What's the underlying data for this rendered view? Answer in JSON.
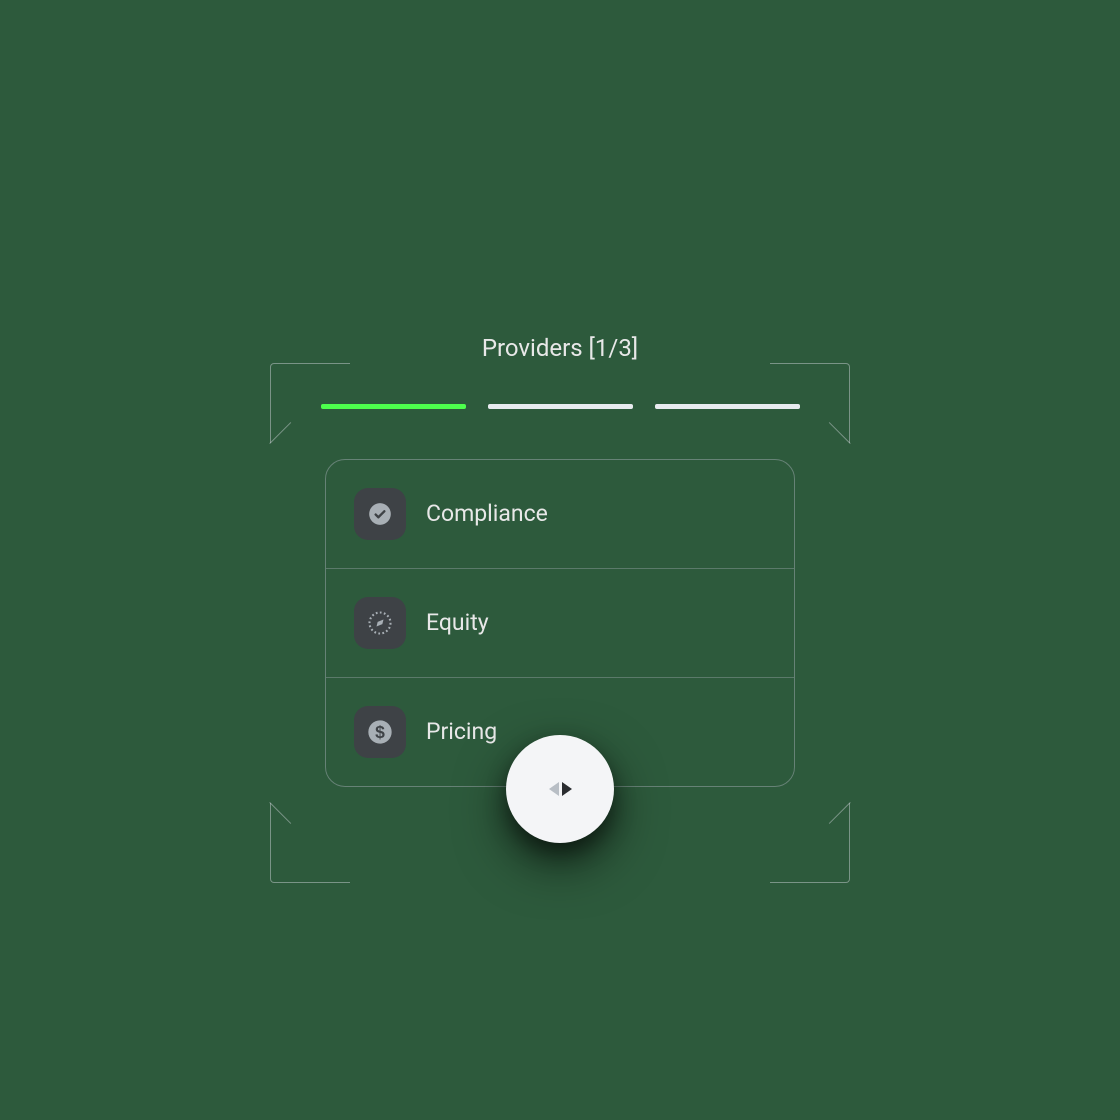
{
  "title": "Providers [1/3]",
  "progress": {
    "current": 1,
    "total": 3
  },
  "items": [
    {
      "icon": "check",
      "label": "Compliance"
    },
    {
      "icon": "compass",
      "label": "Equity"
    },
    {
      "icon": "dollar",
      "label": "Pricing"
    }
  ]
}
